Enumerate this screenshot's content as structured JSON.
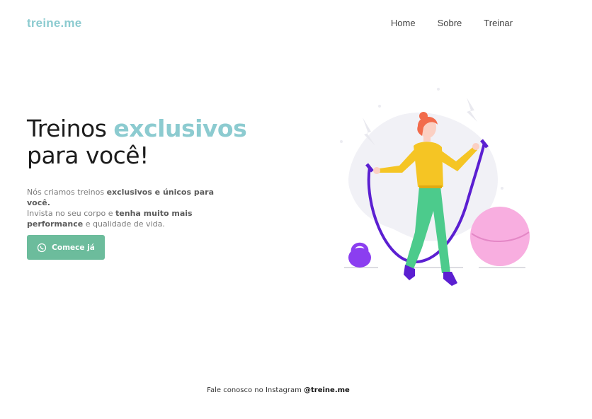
{
  "header": {
    "logo": "treine.me",
    "nav": [
      {
        "label": "Home"
      },
      {
        "label": "Sobre"
      },
      {
        "label": "Treinar"
      }
    ]
  },
  "hero": {
    "title_part1": "Treinos ",
    "title_accent": "exclusivos",
    "title_part2": "para você!",
    "text": {
      "t1": "Nós criamos treinos ",
      "b1": "exclusivos e únicos para você.",
      "t2": "Invista no seu corpo e ",
      "b2": "tenha muito mais performance",
      "t3": " e qualidade de vida."
    },
    "cta_label": "Comece já",
    "cta_icon": "whatsapp-icon"
  },
  "illustration": {
    "name": "jump-rope-woman-illustration"
  },
  "footer": {
    "text": "Fale conosco no Instagram ",
    "handle": "@treine.me"
  },
  "colors": {
    "brand": "#8ccbd0",
    "button": "#6cbc9c",
    "text_dark": "#1c1c1c",
    "text_muted": "#7a7a7a"
  }
}
